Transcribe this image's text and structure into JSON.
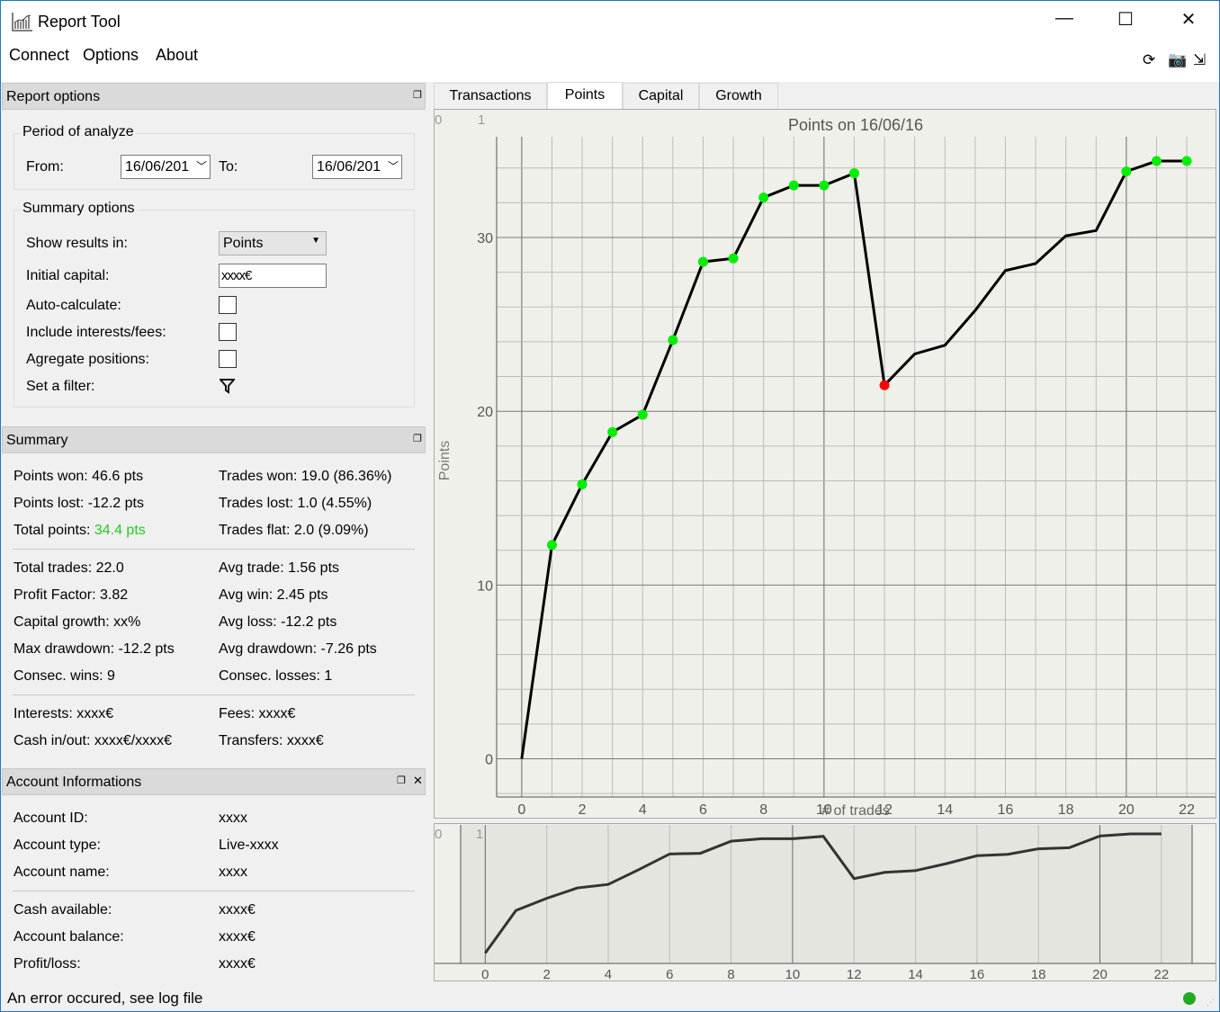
{
  "window": {
    "title": "Report Tool",
    "icon": "chart-app-icon",
    "controls": [
      "minimize",
      "maximize",
      "close"
    ]
  },
  "menu": [
    "Connect",
    "Options",
    "About"
  ],
  "toolbar": {
    "icons": [
      "refresh-icon",
      "camera-icon",
      "export-icon"
    ]
  },
  "report_options": {
    "title": "Report options",
    "period": {
      "title": "Period of analyze",
      "from_label": "From:",
      "from_value": "16/06/201",
      "to_label": "To:",
      "to_value": "16/06/201"
    },
    "summary_options": {
      "title": "Summary options",
      "show_results_label": "Show results in:",
      "show_results_value": "Points",
      "initial_capital_label": "Initial capital:",
      "initial_capital_value": "xxxx€",
      "auto_calc_label": "Auto-calculate:",
      "auto_calc": false,
      "include_fees_label": "Include interests/fees:",
      "include_fees": false,
      "aggregate_label": "Agregate positions:",
      "aggregate": false,
      "filter_label": "Set a filter:"
    }
  },
  "summary": {
    "title": "Summary",
    "points_won": "Points won: 46.6 pts",
    "trades_won": "Trades won: 19.0 (86.36%)",
    "points_lost": "Points lost: -12.2 pts",
    "trades_lost": "Trades lost: 1.0 (4.55%)",
    "total_points_label": "Total points: ",
    "total_points_value": "34.4 pts",
    "trades_flat": "Trades flat: 2.0 (9.09%)",
    "total_trades": "Total trades: 22.0",
    "avg_trade": "Avg trade: 1.56 pts",
    "profit_factor": "Profit Factor: 3.82",
    "avg_win": "Avg win: 2.45 pts",
    "capital_growth": "Capital growth: xx%",
    "avg_loss": "Avg loss: -12.2 pts",
    "max_drawdown": "Max drawdown: -12.2 pts",
    "avg_drawdown": "Avg drawdown: -7.26 pts",
    "consec_wins": "Consec. wins: 9",
    "consec_losses": "Consec. losses: 1",
    "interests": "Interests: xxxx€",
    "fees": "Fees: xxxx€",
    "cash_inout": "Cash in/out: xxxx€/xxxx€",
    "transfers": "Transfers: xxxx€",
    "positive_color": "#22cc22"
  },
  "account": {
    "title": "Account Informations",
    "rows": [
      {
        "label": "Account ID:",
        "value": "xxxx"
      },
      {
        "label": "Account type:",
        "value": "Live-xxxx"
      },
      {
        "label": "Account name:",
        "value": "xxxx"
      },
      {
        "label": "Cash available:",
        "value": "xxxx€"
      },
      {
        "label": "Account balance:",
        "value": "xxxx€"
      },
      {
        "label": "Profit/loss:",
        "value": "xxxx€"
      }
    ]
  },
  "tabs": [
    "Transactions",
    "Points",
    "Capital",
    "Growth"
  ],
  "active_tab": "Points",
  "status": {
    "message": "An error occured, see log file",
    "indicator_color": "#22aa22"
  },
  "chart_data": [
    {
      "type": "line",
      "title": "Points on 16/06/16",
      "xlabel": "# of trades",
      "ylabel": "Points",
      "corner_labels": [
        "0",
        "1"
      ],
      "x": [
        0,
        1,
        2,
        3,
        4,
        5,
        6,
        7,
        8,
        9,
        10,
        11,
        12,
        13,
        14,
        15,
        16,
        17,
        18,
        19,
        20,
        21,
        22
      ],
      "y": [
        0,
        12.3,
        15.8,
        18.8,
        19.8,
        24.1,
        28.6,
        28.8,
        32.3,
        33.0,
        33.0,
        33.7,
        21.5,
        23.3,
        23.8,
        25.8,
        28.1,
        28.5,
        30.1,
        30.4,
        33.8,
        34.4,
        34.4
      ],
      "markers": [
        "none",
        "win",
        "win",
        "win",
        "win",
        "win",
        "win",
        "win",
        "win",
        "win",
        "win",
        "win",
        "loss",
        "none",
        "none",
        "none",
        "none",
        "none",
        "none",
        "none",
        "win",
        "win",
        "win"
      ],
      "marker_colors": {
        "win": "#00ee00",
        "loss": "#ff0000"
      },
      "xlim": [
        -0.83,
        22.95
      ],
      "ylim": [
        -2.2,
        35.8
      ],
      "xticks": [
        0,
        2,
        4,
        6,
        8,
        10,
        12,
        14,
        16,
        18,
        20,
        22
      ],
      "yticks": [
        0,
        10,
        20,
        30
      ],
      "grid": true
    },
    {
      "type": "line",
      "title": "",
      "corner_labels": [
        "0",
        "1"
      ],
      "x": [
        0,
        1,
        2,
        3,
        4,
        5,
        6,
        7,
        8,
        9,
        10,
        11,
        12,
        13,
        14,
        15,
        16,
        17,
        18,
        19,
        20,
        21,
        22
      ],
      "y": [
        0,
        12.3,
        15.8,
        18.8,
        19.8,
        24.1,
        28.6,
        28.8,
        32.3,
        33.0,
        33.0,
        33.7,
        21.5,
        23.3,
        23.8,
        25.8,
        28.1,
        28.5,
        30.1,
        30.4,
        33.8,
        34.4,
        34.4
      ],
      "xlim": [
        -0.8,
        23.0
      ],
      "ylim": [
        -3,
        37
      ],
      "xticks": [
        0,
        2,
        4,
        6,
        8,
        10,
        12,
        14,
        16,
        18,
        20,
        22
      ],
      "grid": true
    }
  ]
}
